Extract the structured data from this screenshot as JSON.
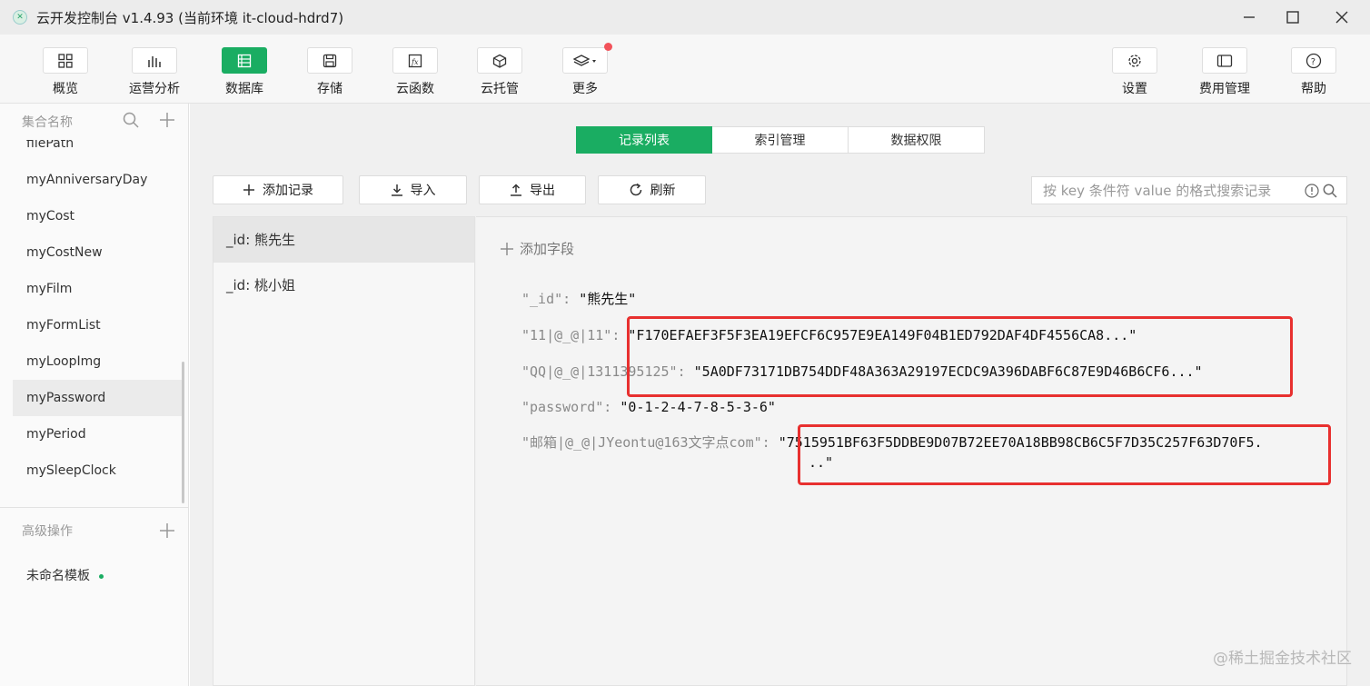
{
  "window": {
    "title": "云开发控制台 v1.4.93 (当前环境 it-cloud-hdrd7)",
    "controls": [
      "minimize",
      "maximize",
      "close"
    ]
  },
  "toolbar": {
    "left": [
      {
        "label": "概览",
        "icon": "grid-icon"
      },
      {
        "label": "运营分析",
        "icon": "bar-chart-icon"
      },
      {
        "label": "数据库",
        "icon": "database-icon",
        "active": true
      },
      {
        "label": "存储",
        "icon": "save-icon"
      },
      {
        "label": "云函数",
        "icon": "function-icon"
      },
      {
        "label": "云托管",
        "icon": "cube-icon"
      },
      {
        "label": "更多",
        "icon": "layers-icon",
        "badge": true
      }
    ],
    "right": [
      {
        "label": "设置",
        "icon": "gear-icon"
      },
      {
        "label": "费用管理",
        "icon": "billing-icon"
      },
      {
        "label": "帮助",
        "icon": "help-icon"
      }
    ]
  },
  "sidebar": {
    "collections_header": "集合名称",
    "collections": [
      "filePath",
      "myAnniversaryDay",
      "myCost",
      "myCostNew",
      "myFilm",
      "myFormList",
      "myLoopImg",
      "myPassword",
      "myPeriod",
      "mySleepClock"
    ],
    "selected_collection": "myPassword",
    "advanced_header": "高级操作",
    "templates": [
      "未命名模板"
    ]
  },
  "main": {
    "tabs": [
      {
        "label": "记录列表",
        "active": true
      },
      {
        "label": "索引管理"
      },
      {
        "label": "数据权限"
      }
    ],
    "actions": {
      "add": "添加记录",
      "import": "导入",
      "export": "导出",
      "refresh": "刷新"
    },
    "search": {
      "placeholder": "按 key 条件符 value 的格式搜索记录"
    },
    "documents": [
      "_id: 熊先生",
      "_id: 桃小姐"
    ],
    "selected_document": "_id: 熊先生",
    "add_field": "添加字段",
    "fields": [
      {
        "key": "\"_id\": ",
        "value": "\"熊先生\""
      },
      {
        "key": "\"11|@_@|11\": ",
        "value": "\"F170EFAEF3F5F3EA19EFCF6C957E9EA149F04B1ED792DAF4DF4556CA8...\""
      },
      {
        "key": "\"QQ|@_@|1311395125\": ",
        "value": "\"5A0DF73171DB754DDF48A363A29197ECDC9A396DABF6C87E9D46B6CF6...\""
      },
      {
        "key": "\"password\": ",
        "value": "\"0-1-2-4-7-8-5-3-6\""
      },
      {
        "key": "\"邮箱|@_@|JYeontu@163文字点com\": ",
        "value": "\"7515951BF63F5DDBE9D07B72EE70A18BB98CB6C5F7D35C257F63D70F5.",
        "value_cont": "..\""
      }
    ]
  },
  "watermark": "@稀土掘金技术社区",
  "colors": {
    "accent": "#1aad62",
    "highlight": "#e8302f",
    "badge": "#f2525a"
  }
}
